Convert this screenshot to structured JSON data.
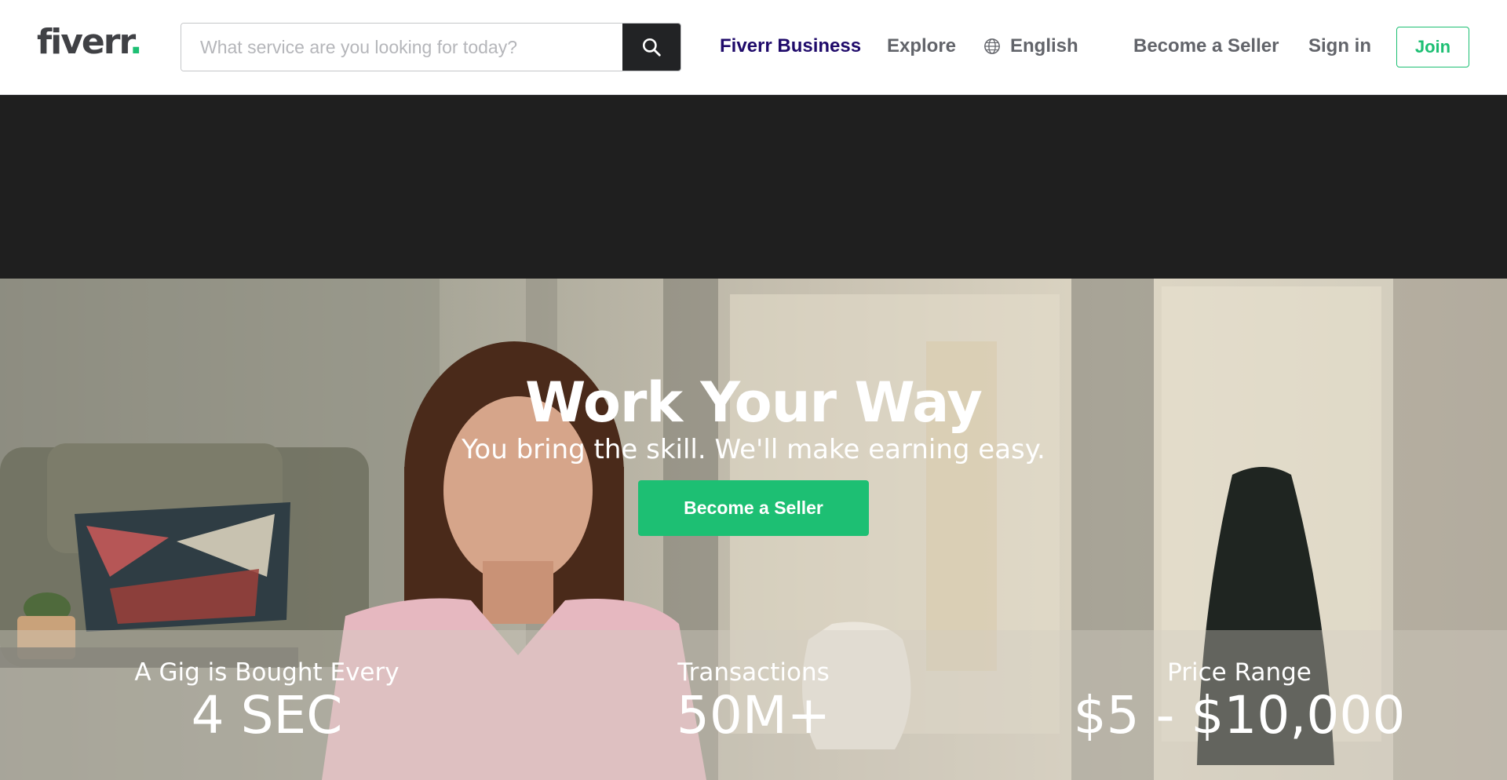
{
  "header": {
    "logo_text": "fiverr",
    "logo_dot": ".",
    "search": {
      "placeholder": "What service are you looking for today?",
      "value": ""
    },
    "nav": {
      "business": "Fiverr Business",
      "explore": "Explore",
      "language": "English",
      "become_seller": "Become a Seller",
      "sign_in": "Sign in",
      "join": "Join"
    }
  },
  "hero": {
    "title": "Work Your Way",
    "subtitle": "You bring the skill. We'll make earning easy.",
    "cta": "Become a Seller"
  },
  "stats": [
    {
      "label": "A Gig is Bought Every",
      "value": "4 SEC"
    },
    {
      "label": "Transactions",
      "value": "50M+"
    },
    {
      "label": "Price Range",
      "value": "$5 - $10,000"
    }
  ],
  "icons": {
    "search": "search-icon",
    "language": "globe-icon"
  },
  "colors": {
    "brand_green": "#1dbf73",
    "business_navy": "#1f0a6a",
    "dark_band": "#1f1f1f"
  }
}
